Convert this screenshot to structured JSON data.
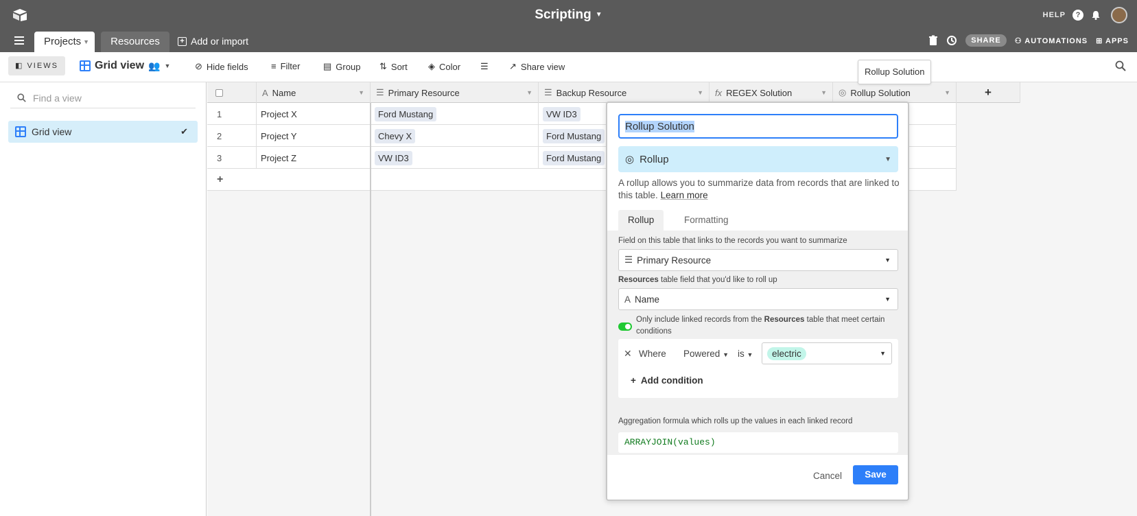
{
  "topbar": {
    "base_title": "Scripting",
    "help": "HELP"
  },
  "tabs": {
    "active": "Projects",
    "second": "Resources",
    "add_import": "Add or import",
    "share": "SHARE",
    "automations": "AUTOMATIONS",
    "apps": "APPS"
  },
  "viewbar": {
    "views": "VIEWS",
    "grid_view": "Grid view",
    "hide_fields": "Hide fields",
    "filter": "Filter",
    "group": "Group",
    "sort": "Sort",
    "color": "Color",
    "share_view": "Share view"
  },
  "tooltip": "Rollup Solution",
  "sidebar": {
    "search_placeholder": "Find a view",
    "item": "Grid view"
  },
  "grid": {
    "columns": [
      "Name",
      "Primary Resource",
      "Backup Resource",
      "REGEX Solution",
      "Rollup Solution"
    ],
    "rows": [
      {
        "num": "1",
        "name": "Project X",
        "primary": "Ford Mustang",
        "backup": "VW ID3"
      },
      {
        "num": "2",
        "name": "Project Y",
        "primary": "Chevy X",
        "backup": "Ford Mustang"
      },
      {
        "num": "3",
        "name": "Project Z",
        "primary": "VW ID3",
        "backup": "Ford Mustang"
      }
    ],
    "add_row": "+",
    "add_col": "+"
  },
  "popover": {
    "field_name": "Rollup Solution",
    "type": "Rollup",
    "description": "A rollup allows you to summarize data from records that are linked to this table.",
    "learn_more": "Learn more",
    "tab_rollup": "Rollup",
    "tab_formatting": "Formatting",
    "link_label": "Field on this table that links to the records you want to summarize",
    "link_value": "Primary Resource",
    "rollup_label_bold": "Resources",
    "rollup_label_rest": " table field that you'd like to roll up",
    "rollup_value": "Name",
    "toggle_pre": "Only include linked records from the ",
    "toggle_bold": "Resources",
    "toggle_post": " table that meet certain conditions",
    "cond_where": "Where",
    "cond_field": "Powered",
    "cond_op": "is",
    "cond_value": "electric",
    "add_condition": "Add condition",
    "agg_label": "Aggregation formula which rolls up the values in each linked record",
    "formula": "ARRAYJOIN(values)",
    "cancel": "Cancel",
    "save": "Save"
  },
  "colors": {
    "topbar": "#5a5a5a",
    "accent": "#2d7ff9",
    "toggle_on": "#20c933",
    "selected_view": "#d6eefa",
    "pill": "#c2f5e9"
  }
}
